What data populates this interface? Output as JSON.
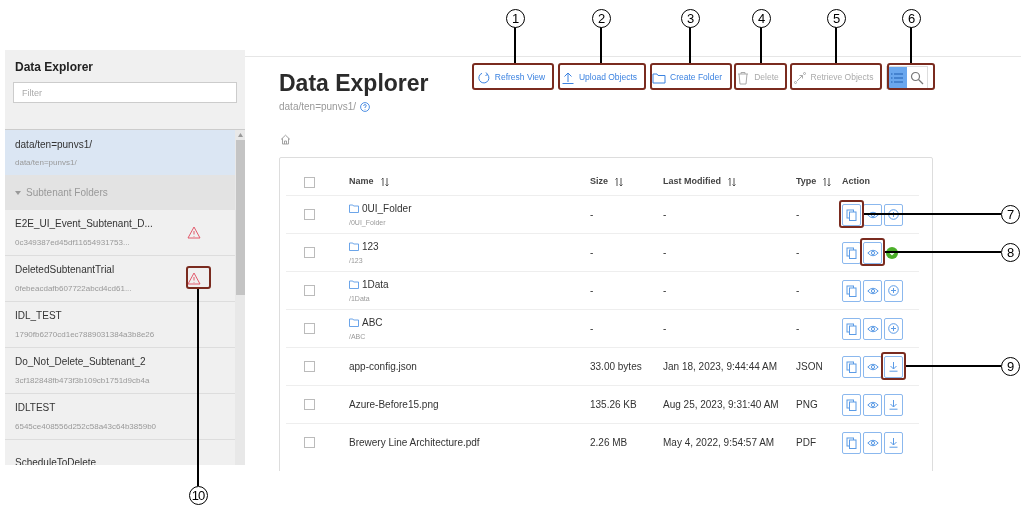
{
  "sidebar": {
    "title": "Data Explorer",
    "filter": {
      "placeholder": "Filter"
    },
    "root_item": {
      "name": "data/ten=punvs1/",
      "path": "data/ten=punvs1/",
      "selected": true
    },
    "subtenant_folders": {
      "label": "Subtenant Folders",
      "expanded": true,
      "items": [
        {
          "name": "E2E_UI_Event_Subtenant_D...",
          "id": "0c349387ed45df11654931753...",
          "warning": true
        },
        {
          "name": "DeletedSubtenantTrial",
          "id": "0febeacdafb607722abcd4cd61...",
          "warning": true
        },
        {
          "name": "IDL_TEST",
          "id": "1790fb6270cd1ec7889031384a3b8e26",
          "warning": false
        },
        {
          "name": "Do_Not_Delete_Subtenant_2",
          "id": "3cf182848fb473f3b109cb1751d9cb4a",
          "warning": false
        },
        {
          "name": "IDLTEST",
          "id": "6545ce408556d252c58a43c64b3859b0",
          "warning": false
        },
        {
          "name": "ScheduleToDelete",
          "warning": false
        }
      ]
    }
  },
  "main": {
    "title": "Data Explorer",
    "path": "data/ten=punvs1/",
    "toolbar": [
      {
        "kind": "refresh",
        "label": "Refresh View",
        "disabled": false
      },
      {
        "kind": "upload",
        "label": "Upload Objects",
        "disabled": false
      },
      {
        "kind": "folder",
        "label": "Create Folder",
        "disabled": false
      },
      {
        "kind": "delete",
        "label": "Delete",
        "disabled": true
      },
      {
        "kind": "retrieve",
        "label": "Retrieve Objects",
        "disabled": true
      }
    ],
    "view_toggle": [
      {
        "kind": "list",
        "selected": true
      },
      {
        "kind": "search",
        "selected": false
      }
    ],
    "table": {
      "select_all": {
        "checked": false
      },
      "columns": [
        {
          "label": "Name",
          "sortable": true
        },
        {
          "label": "Size",
          "sortable": true
        },
        {
          "label": "Last Modified",
          "sortable": true
        },
        {
          "label": "Type",
          "sortable": true
        },
        {
          "label": "Action",
          "sortable": false
        }
      ],
      "rows": [
        {
          "kind": "folder",
          "name": "0UI_Folder",
          "path": "/0UI_Folder",
          "size": "-",
          "modified": "-",
          "type": "-",
          "checked": false,
          "indicator": false
        },
        {
          "kind": "folder",
          "name": "123",
          "path": "/123",
          "size": "-",
          "modified": "-",
          "type": "-",
          "checked": false,
          "indicator": true
        },
        {
          "kind": "folder",
          "name": "1Data",
          "path": "/1Data",
          "size": "-",
          "modified": "-",
          "type": "-",
          "checked": false,
          "indicator": false
        },
        {
          "kind": "folder",
          "name": "ABC",
          "path": "/ABC",
          "size": "-",
          "modified": "-",
          "type": "-",
          "checked": false,
          "indicator": false
        },
        {
          "kind": "file",
          "name": "app-config.json",
          "size": "33.00 bytes",
          "modified": "Jan 18, 2023, 9:44:44 AM",
          "type": "JSON",
          "checked": false,
          "indicator": false
        },
        {
          "kind": "file",
          "name": "Azure-Before15.png",
          "size": "135.26 KB",
          "modified": "Aug 25, 2023, 9:31:40 AM",
          "type": "PNG",
          "checked": false,
          "indicator": false
        },
        {
          "kind": "file",
          "name": "Brewery Line Architecture.pdf",
          "size": "2.26 MB",
          "modified": "May 4, 2022, 9:54:57 AM",
          "type": "PDF",
          "checked": false,
          "indicator": false
        }
      ]
    }
  },
  "callouts": [
    {
      "number": "1"
    },
    {
      "number": "2"
    },
    {
      "number": "3"
    },
    {
      "number": "4"
    },
    {
      "number": "5"
    },
    {
      "number": "6"
    },
    {
      "number": "7"
    },
    {
      "number": "8"
    },
    {
      "number": "9"
    },
    {
      "number": "10"
    }
  ]
}
